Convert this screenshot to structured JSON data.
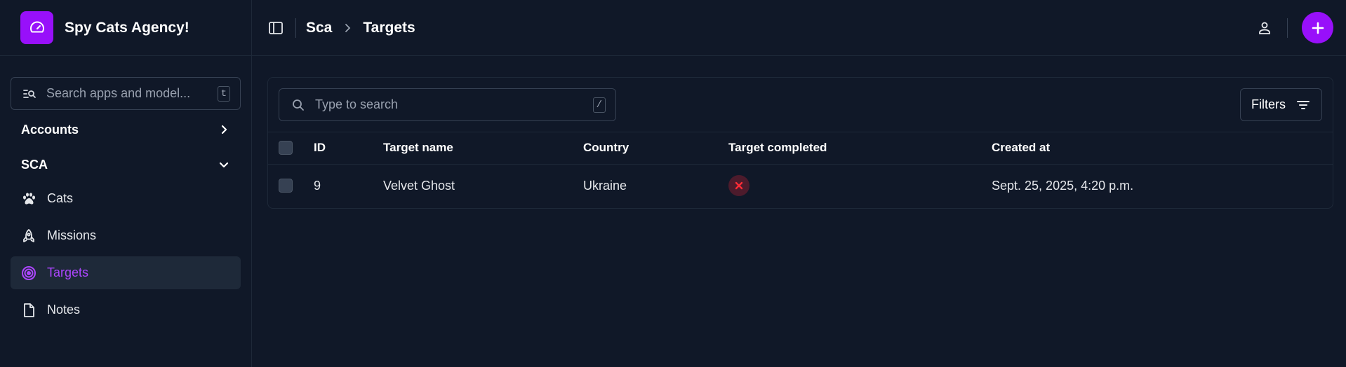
{
  "brand": {
    "title": "Spy Cats Agency!",
    "icon": "dashboard-gauge-icon"
  },
  "sidebar": {
    "search_placeholder": "Search apps and model...",
    "search_shortcut": "t",
    "sections": [
      {
        "label": "Accounts",
        "expanded": false
      },
      {
        "label": "SCA",
        "expanded": true
      }
    ],
    "items": [
      {
        "label": "Cats",
        "icon": "paw-icon",
        "active": false
      },
      {
        "label": "Missions",
        "icon": "rocket-icon",
        "active": false
      },
      {
        "label": "Targets",
        "icon": "target-icon",
        "active": true
      },
      {
        "label": "Notes",
        "icon": "document-icon",
        "active": false
      }
    ]
  },
  "header": {
    "breadcrumb": [
      "Sca",
      "Targets"
    ]
  },
  "toolbar": {
    "search_placeholder": "Type to search",
    "search_shortcut": "/",
    "filters_label": "Filters"
  },
  "table": {
    "columns": [
      "ID",
      "Target name",
      "Country",
      "Target completed",
      "Created at"
    ],
    "rows": [
      {
        "id": "9",
        "name": "Velvet Ghost",
        "country": "Ukraine",
        "completed": false,
        "created_at": "Sept. 25, 2025, 4:20 p.m."
      }
    ]
  },
  "colors": {
    "accent": "#9810fa",
    "active_text": "#ad46ff",
    "background": "#101828",
    "status_false_bg": "#4d1b2c",
    "status_false_fg": "#fb2c36"
  }
}
